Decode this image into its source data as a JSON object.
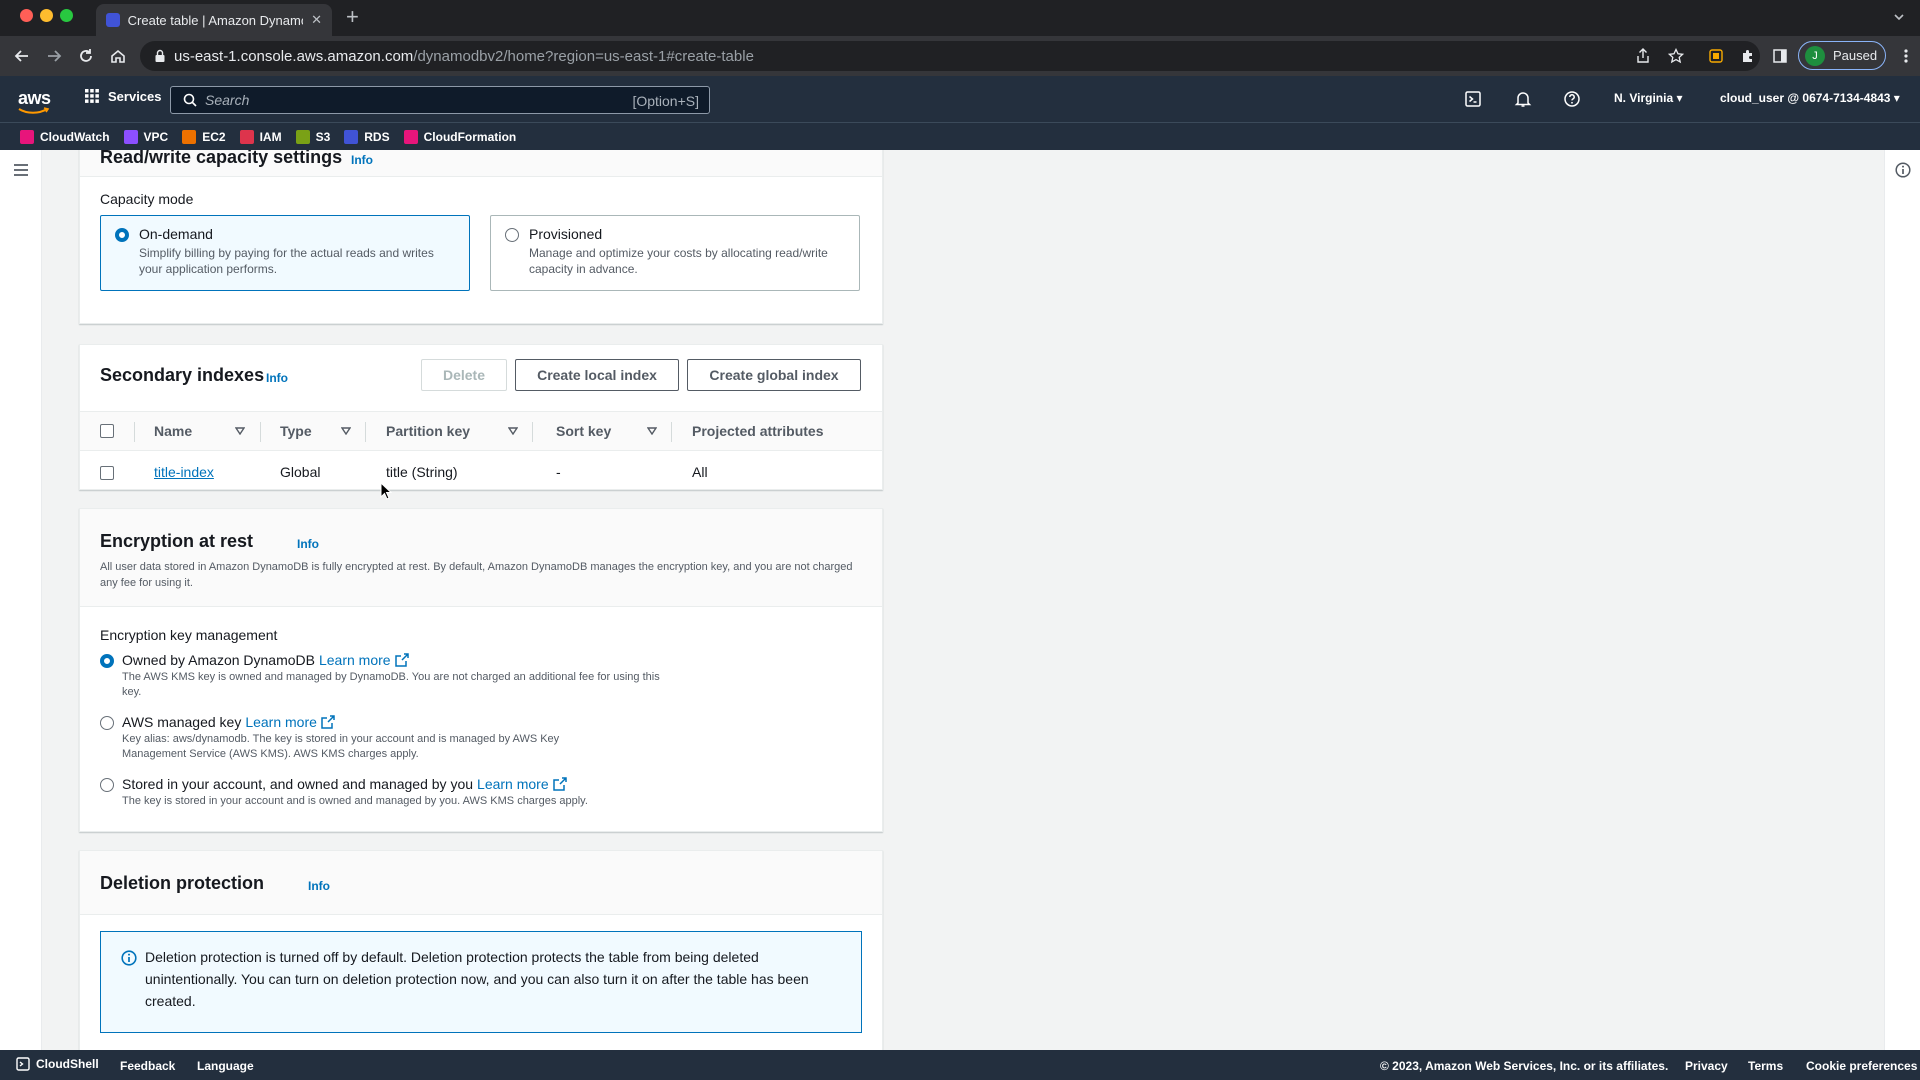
{
  "browser": {
    "tab_title": "Create table | Amazon DynamoDB",
    "url_host": "us-east-1.console.aws.amazon.com",
    "url_path": "/dynamodbv2/home?region=us-east-1#create-table",
    "profile_initial": "J",
    "profile_status": "Paused"
  },
  "aws_header": {
    "logo": "aws",
    "services_label": "Services",
    "search_placeholder": "Search",
    "search_shortcut": "[Option+S]",
    "region": "N. Virginia",
    "user": "cloud_user @ 0674-7134-4843"
  },
  "favorites": [
    {
      "label": "CloudWatch",
      "color": "#e7157b"
    },
    {
      "label": "VPC",
      "color": "#8c4fff"
    },
    {
      "label": "EC2",
      "color": "#ed7100"
    },
    {
      "label": "IAM",
      "color": "#dd344c"
    },
    {
      "label": "S3",
      "color": "#7aa116"
    },
    {
      "label": "RDS",
      "color": "#4053d6"
    },
    {
      "label": "CloudFormation",
      "color": "#e7157b"
    }
  ],
  "capacity": {
    "title": "Read/write capacity settings",
    "info": "Info",
    "mode_label": "Capacity mode",
    "on_demand": {
      "title": "On-demand",
      "desc": "Simplify billing by paying for the actual reads and writes your application performs."
    },
    "provisioned": {
      "title": "Provisioned",
      "desc": "Manage and optimize your costs by allocating read/write capacity in advance."
    }
  },
  "indexes": {
    "title": "Secondary indexes",
    "info": "Info",
    "delete_label": "Delete",
    "create_local_label": "Create local index",
    "create_global_label": "Create global index",
    "columns": [
      "Name",
      "Type",
      "Partition key",
      "Sort key",
      "Projected attributes"
    ],
    "rows": [
      {
        "name": "title-index",
        "type": "Global",
        "partition_key": "title (String)",
        "sort_key": "-",
        "projected": "All"
      }
    ]
  },
  "encryption": {
    "title": "Encryption at rest",
    "info": "Info",
    "desc": "All user data stored in Amazon DynamoDB is fully encrypted at rest. By default, Amazon DynamoDB manages the encryption key, and you are not charged any fee for using it.",
    "key_mgmt_label": "Encryption key management",
    "learn_more": "Learn more",
    "options": [
      {
        "title": "Owned by Amazon DynamoDB",
        "desc": "The AWS KMS key is owned and managed by DynamoDB. You are not charged an additional fee for using this key."
      },
      {
        "title": "AWS managed key",
        "desc": "Key alias: aws/dynamodb. The key is stored in your account and is managed by AWS Key Management Service (AWS KMS). AWS KMS charges apply."
      },
      {
        "title": "Stored in your account, and owned and managed by you",
        "desc": "The key is stored in your account and is owned and managed by you. AWS KMS charges apply."
      }
    ]
  },
  "deletion": {
    "title": "Deletion protection",
    "info": "Info",
    "alert": "Deletion protection is turned off by default. Deletion protection protects the table from being deleted unintentionally. You can turn on deletion protection now, and you can also turn it on after the table has been created."
  },
  "footer": {
    "cloudshell": "CloudShell",
    "feedback": "Feedback",
    "language": "Language",
    "copyright": "© 2023, Amazon Web Services, Inc. or its affiliates.",
    "privacy": "Privacy",
    "terms": "Terms",
    "cookies": "Cookie preferences"
  },
  "colors": {
    "accent": "#0073bb",
    "nav_bg": "#232f3e",
    "chrome_bg": "#202124"
  }
}
